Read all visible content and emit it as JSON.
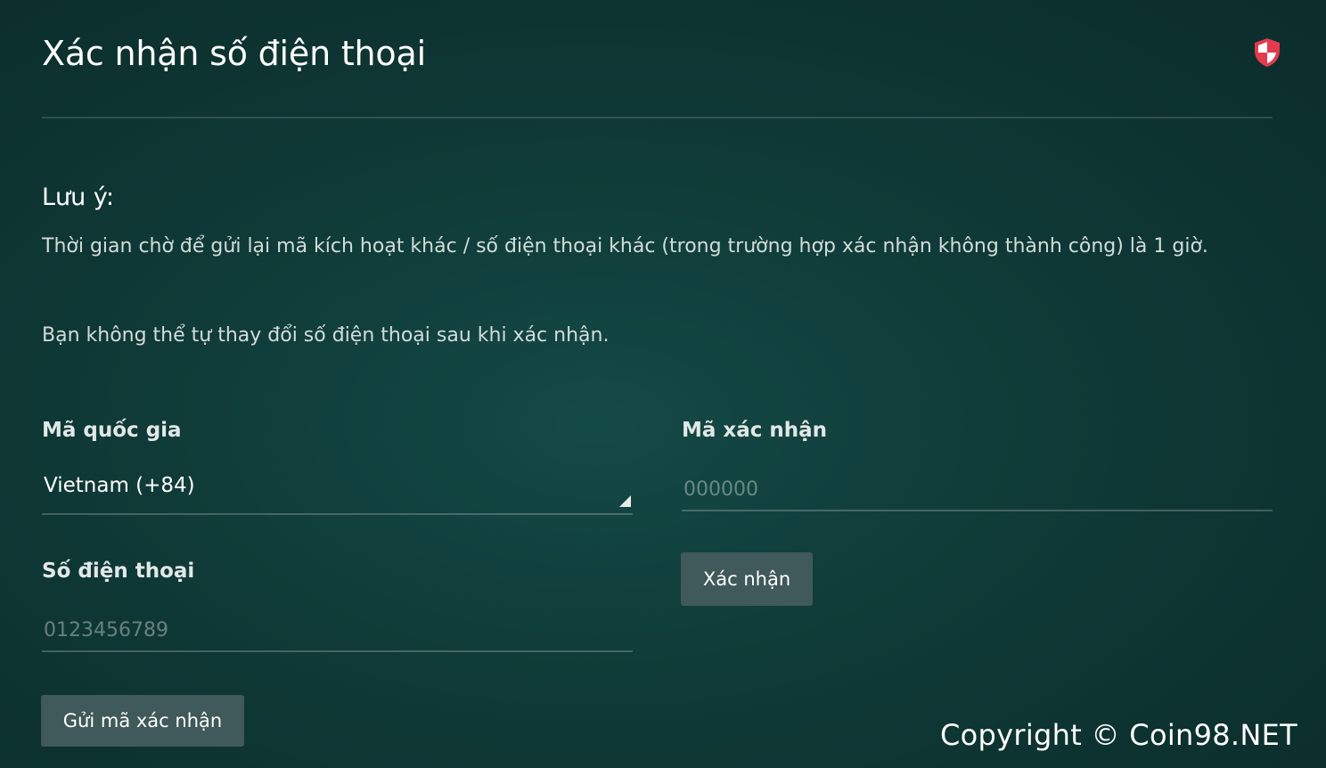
{
  "page": {
    "title": "Xác nhận số điện thoại"
  },
  "icons": {
    "security": "shield-icon",
    "select_arrow": "triangle-corner-icon"
  },
  "note": {
    "heading": "Lưu ý:",
    "paragraphs": [
      "Thời gian chờ để gửi lại mã kích hoạt khác / số điện thoại khác (trong trường hợp xác nhận không thành công) là 1 giờ.",
      "Bạn không thể tự thay đổi số điện thoại sau khi xác nhận."
    ]
  },
  "form": {
    "country": {
      "label": "Mã quốc gia",
      "value": "Vietnam (+84)"
    },
    "phone": {
      "label": "Số điện thoại",
      "placeholder": "0123456789",
      "value": ""
    },
    "send_button_label": "Gửi mã xác nhận",
    "code": {
      "label": "Mã xác nhận",
      "placeholder": "000000",
      "value": ""
    },
    "confirm_button_label": "Xác nhận"
  },
  "footer": {
    "copyright": "Copyright © Coin98.NET"
  },
  "colors": {
    "background": "#0f3a37",
    "button": "#40595a",
    "shield_red": "#e23b4e"
  }
}
